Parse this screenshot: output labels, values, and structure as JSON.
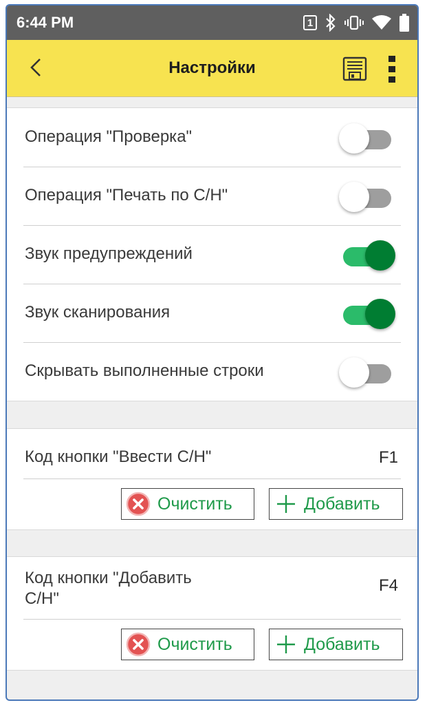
{
  "status": {
    "time": "6:44 PM",
    "sim_slot": "1"
  },
  "appbar": {
    "title": "Настройки"
  },
  "toggles": [
    {
      "label": "Операция \"Проверка\"",
      "on": false
    },
    {
      "label": "Операция \"Печать по С/Н\"",
      "on": false
    },
    {
      "label": "Звук предупреждений",
      "on": true
    },
    {
      "label": "Звук сканирования",
      "on": true
    },
    {
      "label": "Скрывать выполненные строки",
      "on": false
    }
  ],
  "keys": [
    {
      "label": "Код кнопки \"Ввести С/Н\"",
      "value": "F1",
      "clear_label": "Очистить",
      "add_label": "Добавить"
    },
    {
      "label_line1": "Код кнопки \"Добавить",
      "label_line2": "С/Н\"",
      "value": "F4",
      "clear_label": "Очистить",
      "add_label": "Добавить"
    }
  ],
  "colors": {
    "accent_yellow": "#f7e350",
    "toggle_on": "#007d32",
    "button_text": "#1f9a4a"
  }
}
